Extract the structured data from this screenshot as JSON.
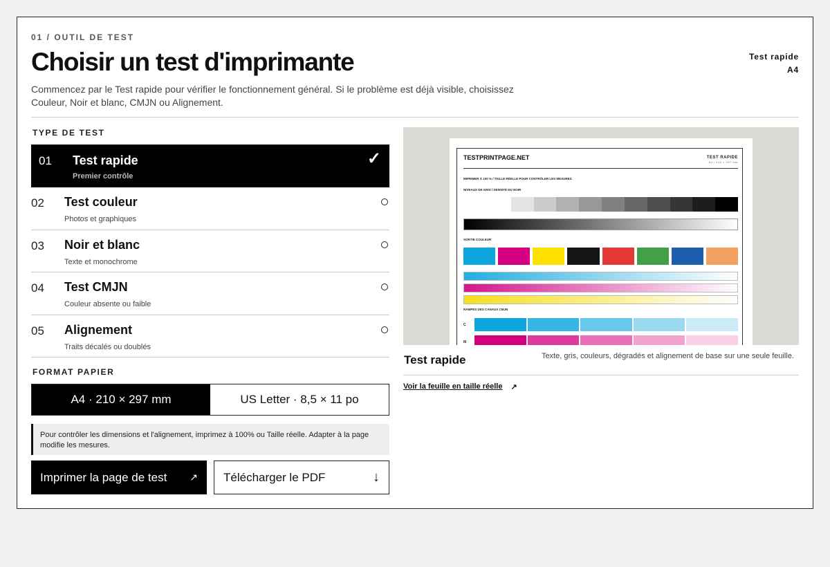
{
  "header": {
    "eyebrow": "01 / OUTIL DE TEST",
    "title": "Choisir un test d'imprimante",
    "intro": "Commencez par le Test rapide pour vérifier le fonctionnement général. Si le problème est déjà visible, choisissez Couleur, Noir et blanc, CMJN ou Alignement.",
    "summary_test": "Test rapide",
    "summary_format": "A4"
  },
  "test_type": {
    "label": "TYPE DE TEST",
    "items": [
      {
        "num": "01",
        "name": "Test rapide",
        "sub": "Premier contrôle",
        "selected": true
      },
      {
        "num": "02",
        "name": "Test couleur",
        "sub": "Photos et graphiques",
        "selected": false
      },
      {
        "num": "03",
        "name": "Noir et blanc",
        "sub": "Texte et monochrome",
        "selected": false
      },
      {
        "num": "04",
        "name": "Test CMJN",
        "sub": "Couleur absente ou faible",
        "selected": false
      },
      {
        "num": "05",
        "name": "Alignement",
        "sub": "Traits décalés ou doublés",
        "selected": false
      }
    ],
    "check_glyph": "✓"
  },
  "paper": {
    "label": "FORMAT PAPIER",
    "options": [
      "A4 · 210 × 297 mm",
      "US Letter · 8,5 × 11 po"
    ],
    "selected": 0,
    "note": "Pour contrôler les dimensions et l'alignement, imprimez à 100% ou Taille réelle. Adapter à la page modifie les mesures."
  },
  "actions": {
    "print_label": "Imprimer la page de test",
    "print_icon": "↗",
    "download_label": "Télécharger le PDF",
    "download_icon": "↓"
  },
  "preview": {
    "sheet": {
      "site": "TESTPRINTPAGE.NET",
      "right_title": "TEST RAPIDE",
      "right_sub": "A4 / 210 × 297 mm",
      "instruction": "IMPRIMER À 100 % / TAILLE RÉELLE POUR CONTRÔLER LES MESURES",
      "gray_label": "NIVEAUX DE GRIS / DENSITÉ DU NOIR",
      "color_label": "SORTIE COULEUR",
      "ramps_label": "RAMPES DES CANAUX CMJN",
      "channel_c": "C",
      "channel_m": "M",
      "gray_steps": [
        "#ffffff",
        "#e4e4e4",
        "#cbcbcb",
        "#b1b1b1",
        "#989898",
        "#818181",
        "#686868",
        "#4f4f4f",
        "#363636",
        "#1d1d1d",
        "#000000"
      ],
      "swatch_colors": [
        "#0ea5dc",
        "#d4007f",
        "#ffe100",
        "#141414",
        "#e53935",
        "#43a047",
        "#1e5fad",
        "#f4a261"
      ],
      "ramp_colors": [
        "#22aee0",
        "#d4148c",
        "#f7de1c"
      ],
      "cyan_tiles": [
        "#0ea5dc",
        "#36b6e2",
        "#68c8ea",
        "#9bd9f1",
        "#cbebf7"
      ],
      "magenta_tiles": [
        "#d4007f",
        "#de3a9b",
        "#e870b6",
        "#f1a3d0",
        "#f8d1e8"
      ]
    },
    "title": "Test rapide",
    "description": "Texte, gris, couleurs, dégradés et alignement de base sur une seule feuille.",
    "link_label": "Voir la feuille en taille réelle",
    "link_icon": "↗"
  }
}
